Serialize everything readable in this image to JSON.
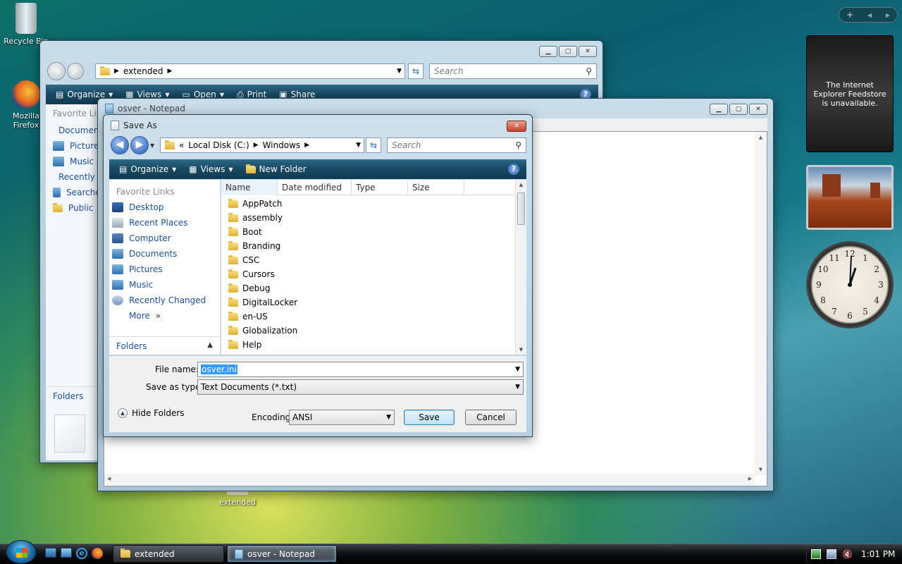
{
  "desktop": {
    "icons": [
      {
        "label": "Recycle Bin",
        "icon": "recycle-bin-icon"
      },
      {
        "label": "Mozilla Firefox",
        "icon": "firefox-icon"
      },
      {
        "label": "extended",
        "icon": "folder-icon"
      }
    ]
  },
  "explorer": {
    "address_folder": "extended",
    "search_placeholder": "Search",
    "toolbar": {
      "organize": "Organize",
      "views": "Views",
      "open": "Open",
      "print": "Print",
      "share": "Share"
    },
    "sidebar_heading": "Favorite Links",
    "sidebar_items": [
      "Documents",
      "Pictures",
      "Music",
      "Recently Changed",
      "Searches",
      "Public"
    ],
    "folders_label": "Folders"
  },
  "notepad": {
    "title": "osver - Notepad"
  },
  "save_dialog": {
    "title": "Save As",
    "breadcrumb": {
      "prefix": "«",
      "disk": "Local Disk (C:)",
      "folder": "Windows"
    },
    "search_placeholder": "Search",
    "toolbar": {
      "organize": "Organize",
      "views": "Views",
      "new_folder": "New Folder"
    },
    "favorite_links_heading": "Favorite Links",
    "favorite_links": [
      "Desktop",
      "Recent Places",
      "Computer",
      "Documents",
      "Pictures",
      "Music",
      "Recently Changed"
    ],
    "more_label": "More",
    "folders_label": "Folders",
    "columns": [
      "Name",
      "Date modified",
      "Type",
      "Size"
    ],
    "files": [
      "AppPatch",
      "assembly",
      "Boot",
      "Branding",
      "CSC",
      "Cursors",
      "Debug",
      "DigitalLocker",
      "en-US",
      "Globalization",
      "Help"
    ],
    "file_name_label": "File name:",
    "file_name_value": "osver.ini",
    "save_as_type_label": "Save as type:",
    "save_as_type_value": "Text Documents (*.txt)",
    "hide_folders": "Hide Folders",
    "encoding_label": "Encoding:",
    "encoding_value": "ANSI",
    "save_button": "Save",
    "cancel_button": "Cancel"
  },
  "sidebar_gadgets": {
    "feed_text": "The Internet Explorer Feedstore is unavailable.",
    "clock_numbers": [
      "12",
      "1",
      "2",
      "3",
      "4",
      "5",
      "6",
      "7",
      "8",
      "9",
      "10",
      "11"
    ]
  },
  "taskbar": {
    "tasks": [
      "extended",
      "osver - Notepad"
    ],
    "time": "1:01 PM"
  }
}
